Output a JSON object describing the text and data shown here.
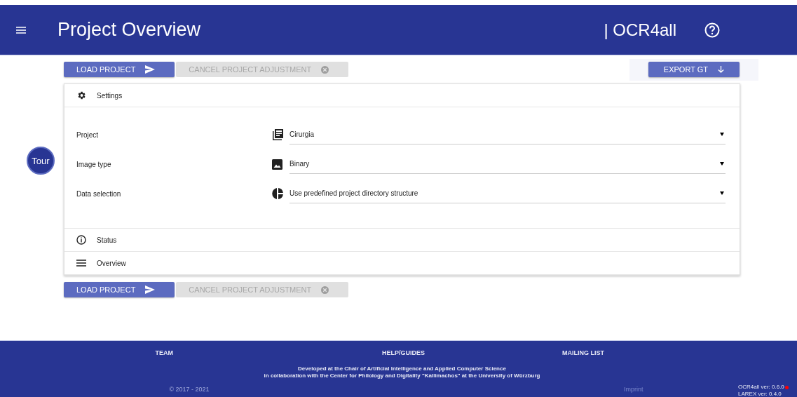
{
  "header": {
    "title": "Project Overview",
    "brand": "| OCR4all"
  },
  "tour_button": {
    "label": "Tour"
  },
  "top_actions": [
    {
      "kind": "primary",
      "label": "LOAD PROJECT",
      "disabled": false
    },
    {
      "kind": "flat",
      "label": "CANCEL PROJECT ADJUSTMENT",
      "disabled": true
    }
  ],
  "export_button": {
    "label": "EXPORT GT",
    "disabled": false
  },
  "sections": [
    {
      "title": "Settings",
      "fields": [
        {
          "label": "Project",
          "value": "Cirurgia"
        },
        {
          "label": "Image type",
          "value": "Binary"
        },
        {
          "label": "Data selection",
          "value": "Use predefined project directory structure"
        }
      ]
    },
    {
      "title": "Status"
    },
    {
      "title": "Overview"
    }
  ],
  "bottom_actions": [
    {
      "kind": "primary",
      "label": "LOAD PROJECT",
      "disabled": false
    },
    {
      "kind": "flat",
      "label": "CANCEL PROJECT ADJUSTMENT",
      "disabled": true
    }
  ],
  "footer": {
    "links": [
      "TEAM",
      "HELP/GUIDES",
      "MAILING LIST"
    ],
    "credit_lines": [
      "Developed at the Chair of Artificial Intelligence and Applied Computer Science",
      "in collaboration with the Center for Philology and Digitality \"Kallimachos\" at the University of Würzburg"
    ],
    "copyright": "© 2017 - 2021",
    "imprint": "Imprint",
    "versions": [
      {
        "text": "OCR4all ver: 0.6.0",
        "update_available": true
      },
      {
        "text": "LAREX ver: 0.4.0",
        "update_available": false
      }
    ]
  }
}
